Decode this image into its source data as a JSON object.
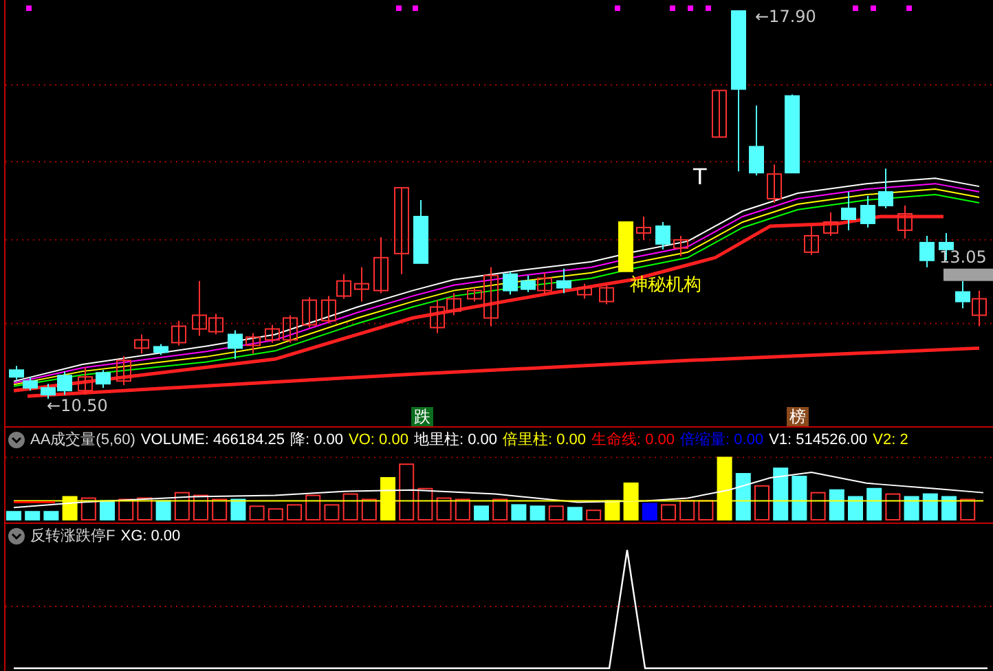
{
  "main_chart": {
    "high_label": "←17.90",
    "low_label": "←10.50",
    "last_price": "13.05",
    "t_mark": "T",
    "annotation": "神秘机构",
    "signals": [
      {
        "text": "跌",
        "color": "#0b6e1e"
      },
      {
        "text": "榜",
        "color": "#8a4a1c"
      }
    ]
  },
  "volume_panel": {
    "title": "AA成交量(5,60)",
    "readings": [
      {
        "text": "VOLUME: 466184.25",
        "color": "#ffffff"
      },
      {
        "text": "降: 0.00",
        "color": "#ffffff"
      },
      {
        "text": "VO: 0.00",
        "color": "#ffff00"
      },
      {
        "text": "地里柱: 0.00",
        "color": "#ffffff"
      },
      {
        "text": "倍里柱: 0.00",
        "color": "#ffff00"
      },
      {
        "text": "生命线: 0.00",
        "color": "#ff0000"
      },
      {
        "text": "倍缩量: 0.00",
        "color": "#0000ff"
      },
      {
        "text": "V1: 514526.00",
        "color": "#ffffff"
      },
      {
        "text": "V2: 2",
        "color": "#ffff00"
      }
    ]
  },
  "signal_panel": {
    "title": "反转涨跌停F",
    "readings": [
      {
        "text": "XG: 0.00",
        "color": "#ffffff"
      }
    ]
  }
}
